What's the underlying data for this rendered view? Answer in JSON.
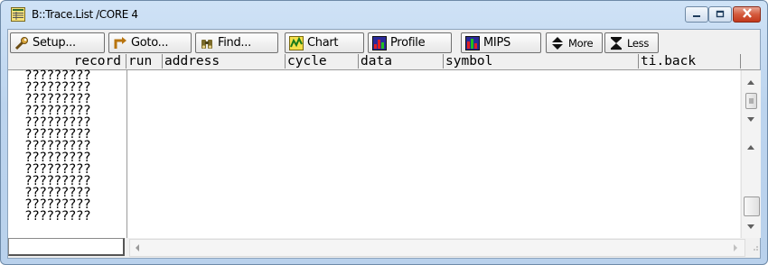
{
  "window": {
    "title": "B::Trace.List /CORE 4",
    "icons": {
      "app": "trace-list-icon",
      "minimize": "minimize-icon",
      "maximize": "maximize-icon",
      "close": "close-icon"
    }
  },
  "toolbar": {
    "setup": "Setup...",
    "goto": "Goto...",
    "find": "Find...",
    "chart": "Chart",
    "profile": "Profile",
    "mips": "MIPS",
    "more": "More",
    "less": "Less"
  },
  "columns": {
    "record": "record",
    "run": "run",
    "address": "address",
    "cycle": "cycle",
    "data": "data",
    "symbol": "symbol",
    "ti_back": "ti.back"
  },
  "records": [
    "?????????",
    "?????????",
    "?????????",
    "?????????",
    "?????????",
    "?????????",
    "?????????",
    "?????????",
    "?????????",
    "?????????",
    "?????????",
    "?????????",
    "?????????"
  ],
  "colors": {
    "title_bg": "#bcd4ee",
    "close_red": "#c2391c",
    "panel": "#f0f0f0"
  }
}
